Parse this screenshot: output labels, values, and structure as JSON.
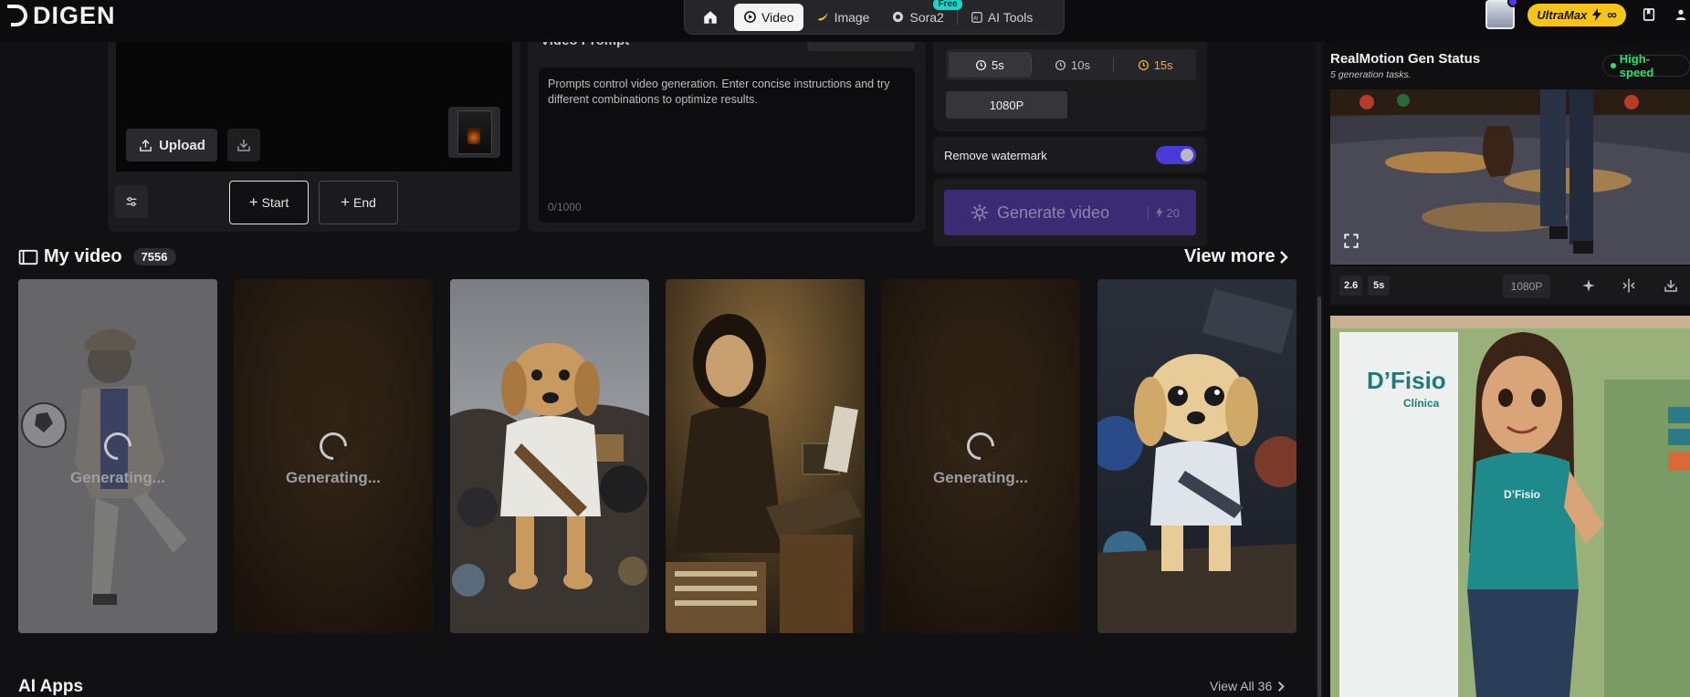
{
  "brand": {
    "name": "DIGEN"
  },
  "nav": {
    "home_icon": "home-icon",
    "items": [
      {
        "label": "Video",
        "icon": "video-icon",
        "active": true
      },
      {
        "label": "Image",
        "icon": "banana-icon"
      },
      {
        "label": "Sora2",
        "icon": "openai-icon",
        "badge": "Free"
      },
      {
        "label": "AI Tools",
        "icon": "ai-icon"
      }
    ]
  },
  "account": {
    "plan": "UltraMax",
    "credits": "∞"
  },
  "upload": {
    "upload_label": "Upload",
    "start_label": "Start",
    "end_label": "End"
  },
  "prompt": {
    "title": "Video Prompt",
    "text": "Prompts control video generation. Enter concise instructions and try different combinations to optimize results.",
    "counter": "0/1000"
  },
  "settings": {
    "durations": [
      "5s",
      "10s",
      "15s"
    ],
    "selected_duration": "5s",
    "resolution": "1080P",
    "watermark_label": "Remove watermark",
    "watermark_on": true,
    "generate_label": "Generate video",
    "generate_cost": "20"
  },
  "my_video": {
    "title": "My video",
    "count": "7556",
    "view_more": "View more",
    "cards": [
      {
        "status": "Generating...",
        "subject": "man kicking soccer ball"
      },
      {
        "status": "Generating...",
        "subject": "golden texture"
      },
      {
        "status": "",
        "subject": "puppy in garbage"
      },
      {
        "status": "",
        "subject": "mona lisa at computer"
      },
      {
        "status": "Generating...",
        "subject": "golden texture"
      },
      {
        "status": "",
        "subject": "cartoon puppy in garbage"
      }
    ]
  },
  "side": {
    "title": "RealMotion Gen Status",
    "subtitle": "5 generation tasks.",
    "speed_badge": "High-speed",
    "controls": {
      "ratio": "2.6",
      "duration": "5s",
      "resolution": "1080P"
    }
  },
  "ai_apps": {
    "title": "AI Apps",
    "view_all": "View All 36"
  },
  "colors": {
    "accent": "#4c3ad8",
    "gold": "#f5c518",
    "speed": "#2fe070"
  }
}
